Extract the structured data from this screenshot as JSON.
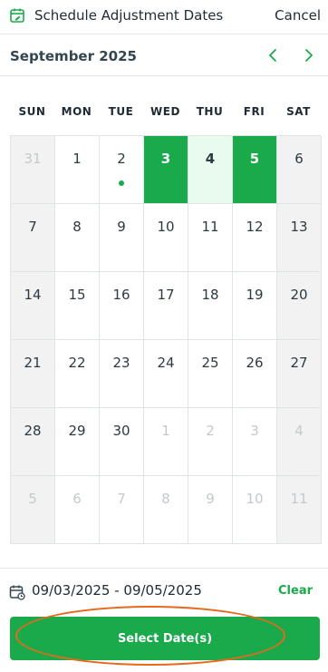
{
  "header": {
    "title": "Schedule Adjustment Dates",
    "cancel_label": "Cancel"
  },
  "calendar": {
    "month_label": "September 2025",
    "weekdays": [
      "SUN",
      "MON",
      "TUE",
      "WED",
      "THU",
      "FRI",
      "SAT"
    ],
    "days": [
      {
        "label": "31",
        "state": "other"
      },
      {
        "label": "1",
        "state": "normal"
      },
      {
        "label": "2",
        "state": "today-dot"
      },
      {
        "label": "3",
        "state": "selected"
      },
      {
        "label": "4",
        "state": "inrange"
      },
      {
        "label": "5",
        "state": "selected"
      },
      {
        "label": "6",
        "state": "normal"
      },
      {
        "label": "7",
        "state": "normal"
      },
      {
        "label": "8",
        "state": "normal"
      },
      {
        "label": "9",
        "state": "normal"
      },
      {
        "label": "10",
        "state": "normal"
      },
      {
        "label": "11",
        "state": "normal"
      },
      {
        "label": "12",
        "state": "normal"
      },
      {
        "label": "13",
        "state": "normal"
      },
      {
        "label": "14",
        "state": "normal"
      },
      {
        "label": "15",
        "state": "normal"
      },
      {
        "label": "16",
        "state": "normal"
      },
      {
        "label": "17",
        "state": "normal"
      },
      {
        "label": "18",
        "state": "normal"
      },
      {
        "label": "19",
        "state": "normal"
      },
      {
        "label": "20",
        "state": "normal"
      },
      {
        "label": "21",
        "state": "normal"
      },
      {
        "label": "22",
        "state": "normal"
      },
      {
        "label": "23",
        "state": "normal"
      },
      {
        "label": "24",
        "state": "normal"
      },
      {
        "label": "25",
        "state": "normal"
      },
      {
        "label": "26",
        "state": "normal"
      },
      {
        "label": "27",
        "state": "normal"
      },
      {
        "label": "28",
        "state": "normal"
      },
      {
        "label": "29",
        "state": "normal"
      },
      {
        "label": "30",
        "state": "normal"
      },
      {
        "label": "1",
        "state": "other"
      },
      {
        "label": "2",
        "state": "other"
      },
      {
        "label": "3",
        "state": "other"
      },
      {
        "label": "4",
        "state": "other"
      },
      {
        "label": "5",
        "state": "other"
      },
      {
        "label": "6",
        "state": "other"
      },
      {
        "label": "7",
        "state": "other"
      },
      {
        "label": "8",
        "state": "other"
      },
      {
        "label": "9",
        "state": "other"
      },
      {
        "label": "10",
        "state": "other"
      },
      {
        "label": "11",
        "state": "other"
      }
    ]
  },
  "footer": {
    "range_text": "09/03/2025 - 09/05/2025",
    "clear_label": "Clear",
    "select_label": "Select Date(s)"
  },
  "colors": {
    "accent": "#1aaa4b",
    "range": "#e8fbee",
    "annotation": "#e8681c"
  },
  "icons": {
    "header": "calendar-edit-icon",
    "prev": "chevron-left-icon",
    "next": "chevron-right-icon",
    "range": "calendar-range-icon"
  }
}
